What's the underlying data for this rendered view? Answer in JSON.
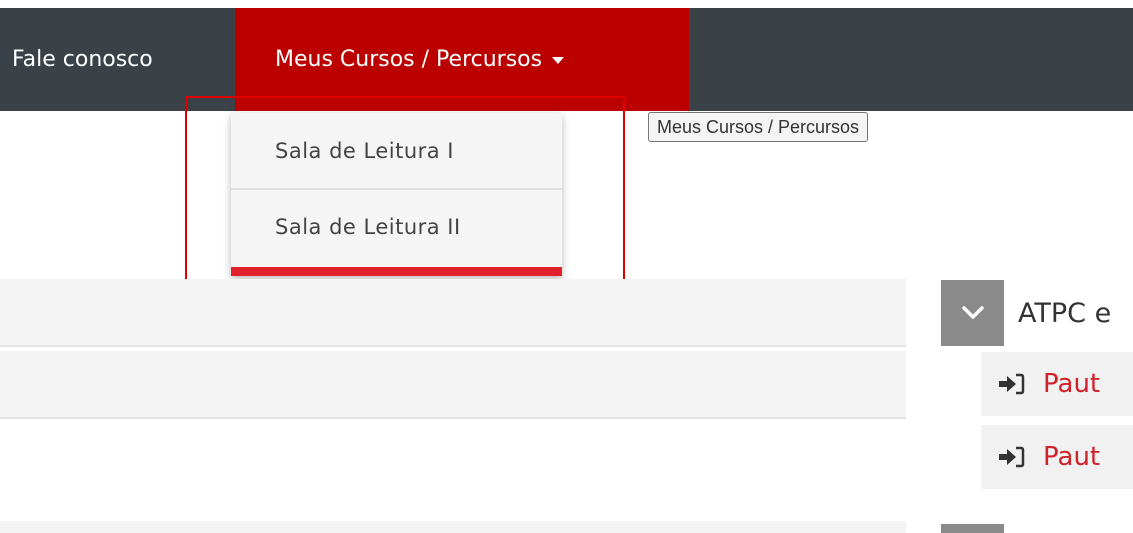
{
  "navbar": {
    "contact_label": "Fale conosco",
    "courses_label": "Meus Cursos / Percursos"
  },
  "tooltip": {
    "text": "Meus Cursos / Percursos"
  },
  "dropdown": {
    "items": [
      {
        "label": "Sala de Leitura I"
      },
      {
        "label": "Sala de Leitura II"
      }
    ]
  },
  "sidebar": {
    "section_title": "ATPC e",
    "links": [
      {
        "label": "Paut",
        "icon": "sign-in-icon"
      },
      {
        "label": "Paut",
        "icon": "sign-in-icon"
      }
    ]
  },
  "colors": {
    "navbar_bg": "#3a4247",
    "active_nav_bg": "#bb0000",
    "accent_red": "#e0202a",
    "link_red": "#d0202a"
  }
}
